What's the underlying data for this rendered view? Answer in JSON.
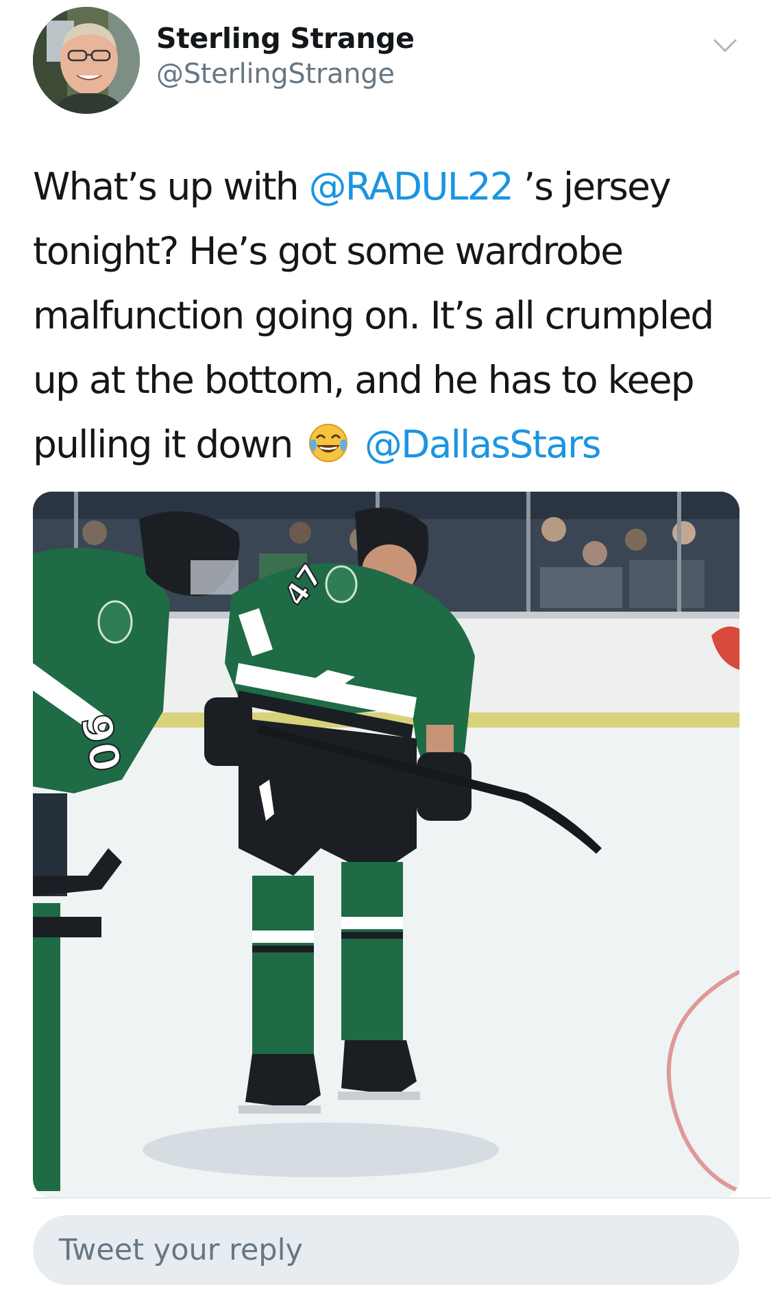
{
  "author": {
    "display_name": "Sterling Strange",
    "handle": "@SterlingStrange",
    "avatar_icon": "profile-photo"
  },
  "menu": {
    "icon": "chevron-down-icon"
  },
  "tweet": {
    "text_part_1": "What’s up with ",
    "mention_1": "@RADUL22",
    "text_part_2": " ’s jersey tonight? He’s got some wardrobe malfunction going on. It’s all crumpled up at the bottom, and he has to keep pulling it down ",
    "emoji": "face-with-tears-of-joy-emoji",
    "text_part_3": " ",
    "mention_2": "@DallasStars"
  },
  "media": {
    "kind": "photo",
    "jersey_numbers": [
      "90",
      "47"
    ]
  },
  "reply_box": {
    "placeholder": "Tweet your reply"
  },
  "colors": {
    "link": "#1b95e0",
    "text": "#14171a",
    "secondary": "#657786",
    "stars_green": "#1e6b45",
    "reply_bg": "#e6ecf0"
  }
}
